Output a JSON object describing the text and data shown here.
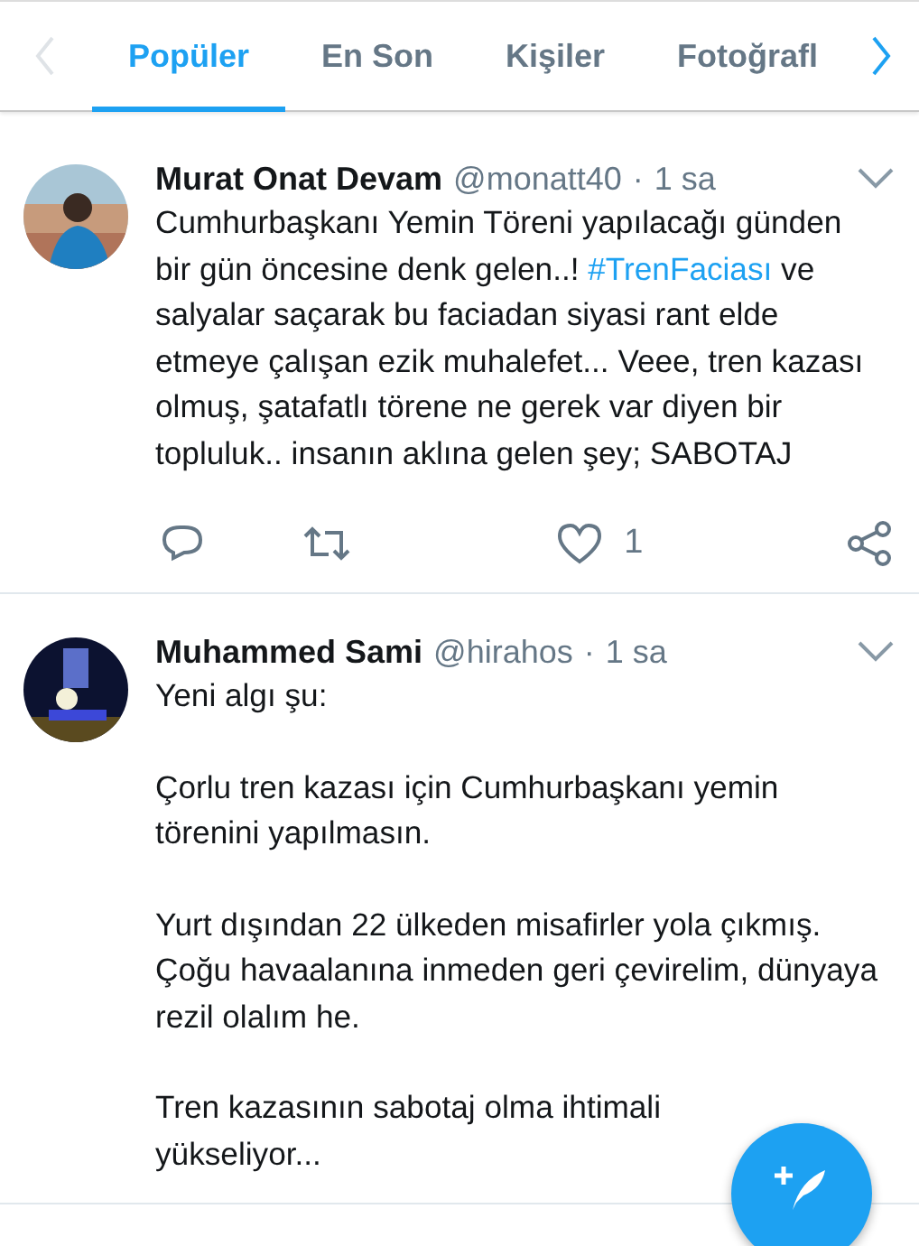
{
  "tabs": [
    {
      "label": "Popüler",
      "selected": true
    },
    {
      "label": "En Son",
      "selected": false
    },
    {
      "label": "Kişiler",
      "selected": false
    },
    {
      "label": "Fotoğrafl",
      "selected": false
    }
  ],
  "scroll_left": {
    "disabled": true
  },
  "scroll_right": {
    "disabled": false
  },
  "tweets": [
    {
      "name": "Murat Onat Devam",
      "handle": "@monatt40",
      "separator": "·",
      "time": "1 sa",
      "paragraphs": [
        [
          {
            "kind": "text",
            "text": "Cumhurbaşkanı Yemin Töreni yapılacağı günden bir gün öncesine denk gelen..! "
          },
          {
            "kind": "hashtag",
            "text": "#TrenFaciası"
          },
          {
            "kind": "text",
            "text": " ve salyalar saçarak bu faciadan siyasi rant elde etmeye çalışan ezik muhalefet... Veee, tren kazası olmuş, şatafatlı törene ne gerek var diyen bir topluluk.. insanın aklına gelen şey; SABOTAJ"
          }
        ]
      ],
      "like_count": "1"
    },
    {
      "name": "Muhammed Sami",
      "handle": "@hirahos",
      "separator": "·",
      "time": "1 sa",
      "paragraphs": [
        [
          {
            "kind": "text",
            "text": "Yeni algı şu:"
          }
        ],
        [
          {
            "kind": "text",
            "text": "Çorlu tren kazası için Cumhurbaşkanı yemin törenini yapılmasın."
          }
        ],
        [
          {
            "kind": "text",
            "text": "Yurt dışından 22 ülkeden misafirler yola çıkmış. Çoğu havaalanına inmeden geri çevirelim, dünyaya rezil olalım he."
          }
        ],
        [
          {
            "kind": "text",
            "text": "Tren kazasının sabotaj olma ihtimali yükseliyor..."
          }
        ]
      ]
    }
  ]
}
